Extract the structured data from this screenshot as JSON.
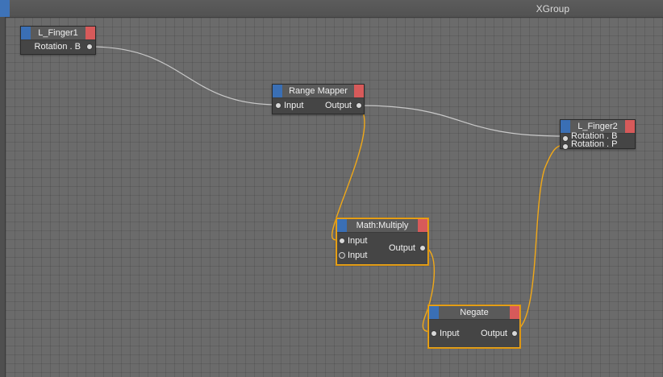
{
  "window": {
    "title": "XGroup"
  },
  "colors": {
    "wire_default": "#c9c9c9",
    "wire_selected": "#f0a818",
    "chip_in": "#3a6fb5",
    "chip_out": "#d75a5a"
  },
  "nodes": {
    "l_finger1": {
      "title": "L_Finger1",
      "out": "Rotation . B"
    },
    "range_mapper": {
      "title": "Range Mapper",
      "in": "Input",
      "out": "Output"
    },
    "l_finger2": {
      "title": "L_Finger2",
      "in1": "Rotation . B",
      "in2": "Rotation . P"
    },
    "math_multiply": {
      "title": "Math:Multiply",
      "in1": "Input",
      "in2": "Input",
      "out": "Output"
    },
    "negate": {
      "title": "Negate",
      "in": "Input",
      "out": "Output"
    }
  }
}
